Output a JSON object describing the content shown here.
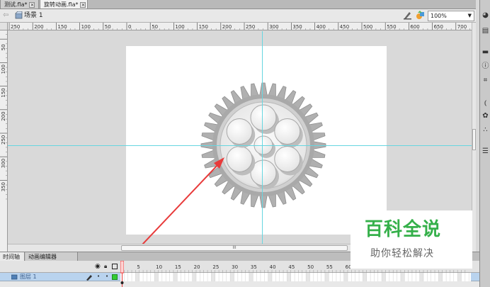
{
  "document_tabs": [
    {
      "label": "测试.fla*",
      "active": false
    },
    {
      "label": "旋转动画.fla*",
      "active": true
    }
  ],
  "edit_bar": {
    "scene_label": "场景 1",
    "zoom": "100%",
    "icons": [
      "back-arrow-icon",
      "scene-icon",
      "edit-scene-icon",
      "edit-symbols-icon"
    ]
  },
  "rulers": {
    "top_ticks": [
      "250",
      "200",
      "150",
      "100",
      "50",
      "0",
      "50",
      "100",
      "150",
      "200",
      "250",
      "300",
      "350",
      "400",
      "450",
      "500",
      "550",
      "600",
      "650",
      "700"
    ],
    "left_ticks": [
      "0",
      "50",
      "100",
      "150",
      "200",
      "250",
      "300",
      "350"
    ]
  },
  "stage": {
    "background": "#ffffff",
    "guide_color": "#66d6e0",
    "object": "gear",
    "gear_color": "#b0b0b0",
    "arrow_color": "#e83a3a"
  },
  "scrollbar": {
    "thumb_grip": "III"
  },
  "timeline": {
    "tabs": [
      "时间轴",
      "动画编辑器"
    ],
    "active_tab": "时间轴",
    "header_icons": [
      "eye-icon",
      "lock-icon",
      "outline-icon"
    ],
    "frame_numbers": [
      "5",
      "10",
      "15",
      "20",
      "25",
      "30",
      "35",
      "40",
      "45",
      "50",
      "55",
      "60"
    ],
    "layers": [
      {
        "name": "图层 1",
        "selected": true
      }
    ],
    "layer_color": "#b9d3ee",
    "outline_color": "#33cc33",
    "playhead_color": "#e83a3a"
  },
  "right_panel": {
    "icons": [
      "color-icon",
      "library-icon",
      "properties-icon",
      "info-icon",
      "transform-icon",
      "actions-icon",
      "components-icon",
      "motion-presets-icon",
      "align-icon"
    ]
  },
  "watermark": {
    "title": "百科全说",
    "subtitle": "助你轻松解决"
  }
}
